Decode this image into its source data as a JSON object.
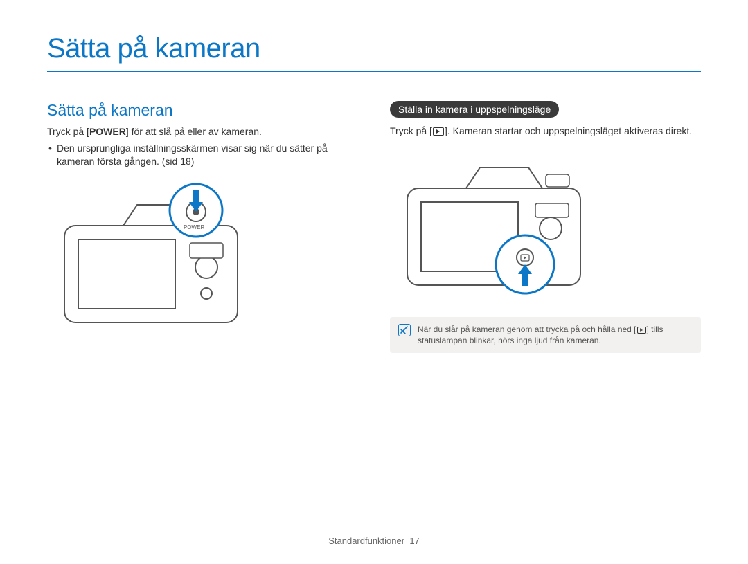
{
  "page": {
    "title": "Sätta på kameran",
    "footer_label": "Standardfunktioner",
    "footer_page": "17"
  },
  "left": {
    "heading": "Sätta på kameran",
    "line1_pre": "Tryck på [",
    "line1_bold": "POWER",
    "line1_post": "] för att slå på eller av kameran.",
    "bullet1": "Den ursprungliga inställningsskärmen visar sig när du sätter på kameran första gången. (sid 18)"
  },
  "right": {
    "pill": "Ställa in kamera i uppspelningsläge",
    "line1_pre": "Tryck på [",
    "line1_post": "]. Kameran startar och uppspelningsläget aktiveras direkt.",
    "note_pre": "När du slår på kameran genom att trycka på och hålla ned [",
    "note_post": "] tills statuslampan blinkar, hörs inga ljud från kameran."
  }
}
